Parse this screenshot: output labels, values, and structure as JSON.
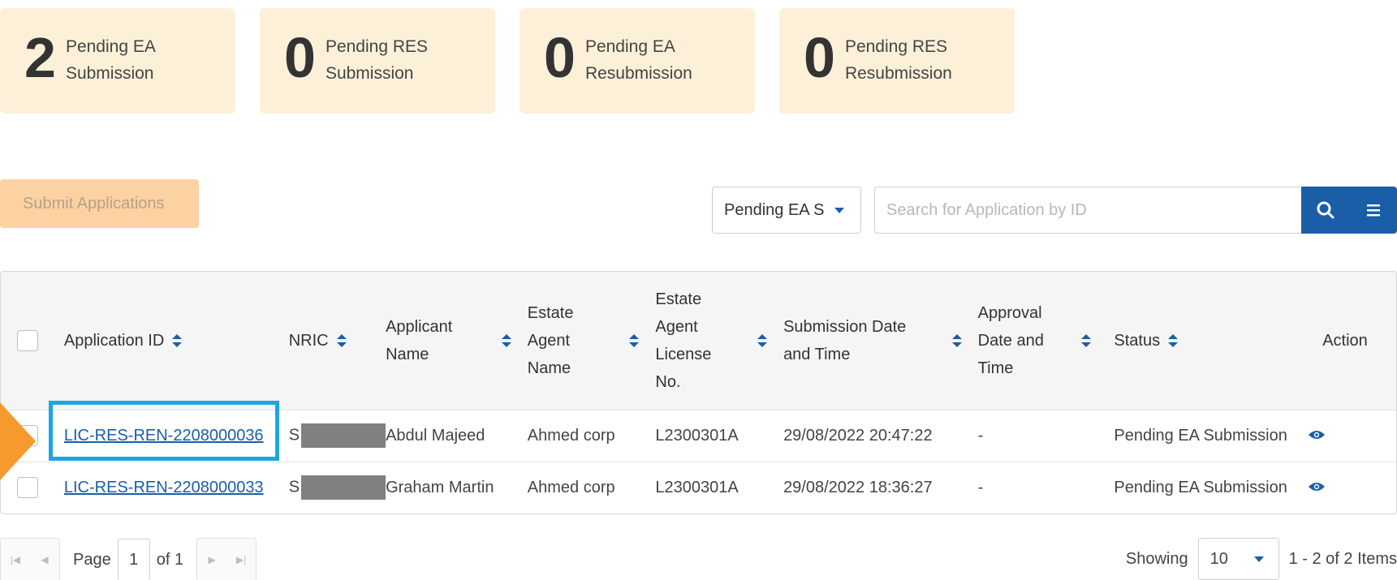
{
  "summary_cards": [
    {
      "count": "2",
      "label_line1": "Pending EA",
      "label_line2": "Submission"
    },
    {
      "count": "0",
      "label_line1": "Pending RES",
      "label_line2": "Submission"
    },
    {
      "count": "0",
      "label_line1": "Pending EA",
      "label_line2": "Resubmission"
    },
    {
      "count": "0",
      "label_line1": "Pending RES",
      "label_line2": "Resubmission"
    }
  ],
  "toolbar": {
    "submit_label": "Submit Applications",
    "filter_value": "Pending EA S",
    "search_placeholder": "Search for Application by ID"
  },
  "table": {
    "headers": {
      "application_id": "Application ID",
      "nric": "NRIC",
      "applicant_name": [
        "Applicant",
        "Name"
      ],
      "estate_agent_name": [
        "Estate",
        "Agent",
        "Name"
      ],
      "estate_agent_license": [
        "Estate",
        "Agent",
        "License",
        "No."
      ],
      "submission_date": [
        "Submission Date",
        "and Time"
      ],
      "approval_date": [
        "Approval",
        "Date and",
        "Time"
      ],
      "status": "Status",
      "action": "Action"
    },
    "rows": [
      {
        "application_id": "LIC-RES-REN-2208000036",
        "nric_prefix": "S",
        "applicant_name": "Abdul Majeed",
        "estate_agent_name": "Ahmed corp",
        "license_no": "L2300301A",
        "submission_date": "29/08/2022 20:47:22",
        "approval_date": "-",
        "status": "Pending EA Submission"
      },
      {
        "application_id": "LIC-RES-REN-2208000033",
        "nric_prefix": "S",
        "applicant_name": "Graham Martin",
        "estate_agent_name": "Ahmed corp",
        "license_no": "L2300301A",
        "submission_date": "29/08/2022 18:36:27",
        "approval_date": "-",
        "status": "Pending EA Submission"
      }
    ]
  },
  "pager": {
    "page_label": "Page",
    "page_value": "1",
    "of_label": "of 1",
    "showing_label": "Showing",
    "page_size": "10",
    "items_summary": "1 - 2 of 2 Items"
  },
  "colors": {
    "card_bg": "#fdf0d8",
    "accent_blue": "#1a5ea8",
    "submit_disabled_bg": "#fcd2a3",
    "highlight_border": "#1ea5e0",
    "arrow_orange": "#f79a2e"
  }
}
